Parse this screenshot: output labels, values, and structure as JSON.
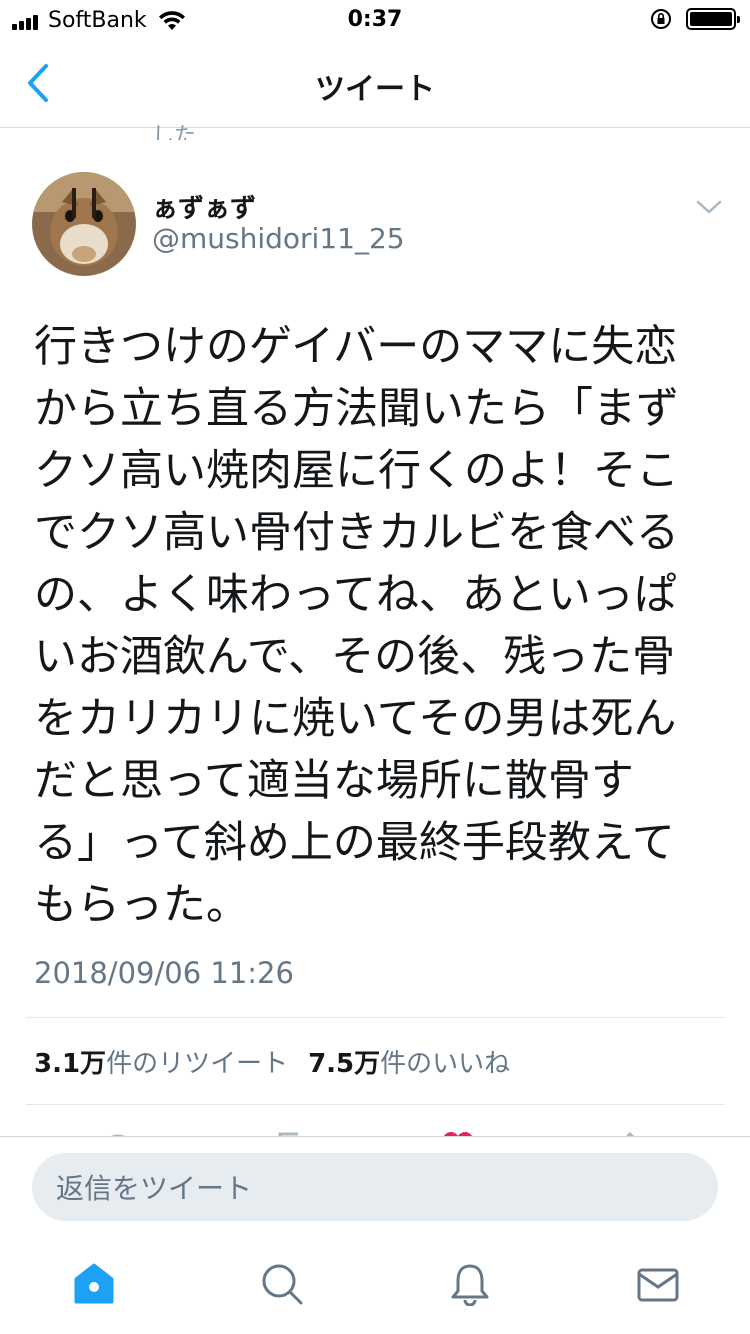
{
  "status_bar": {
    "carrier": "SoftBank",
    "time": "0:37"
  },
  "nav": {
    "title": "ツイート",
    "back_icon": "chevron-left-icon"
  },
  "clipped_text": "した",
  "tweet": {
    "display_name": "ぁずぁず",
    "handle": "@mushidori11_25",
    "text_lines": [
      "行きつけのゲイバーのママに失恋",
      "から立ち直る方法聞いたら「まず",
      "クソ高い焼肉屋に行くのよ！そこ",
      "でクソ高い骨付きカルビを食べる",
      "の、よく味わってね、あといっぱ",
      "いお酒飲んで、その後、残った骨",
      "をカリカリに焼いてその男は死ん",
      "だと思って適当な場所に散骨す",
      "る」って斜め上の最終手段教えて",
      "もらった。"
    ],
    "timestamp": "2018/09/06 11:26"
  },
  "stats": {
    "retweets_count": "3.1万",
    "retweets_label": "件のリツイート",
    "likes_count": "7.5万",
    "likes_label": "件のいいね"
  },
  "reply": {
    "placeholder": "返信をツイート"
  },
  "tabs": {
    "items": [
      "home-icon",
      "search-icon",
      "notifications-icon",
      "messages-icon"
    ]
  },
  "colors": {
    "accent": "#1da1f2",
    "like": "#e0245e",
    "secondary_text": "#657786"
  }
}
